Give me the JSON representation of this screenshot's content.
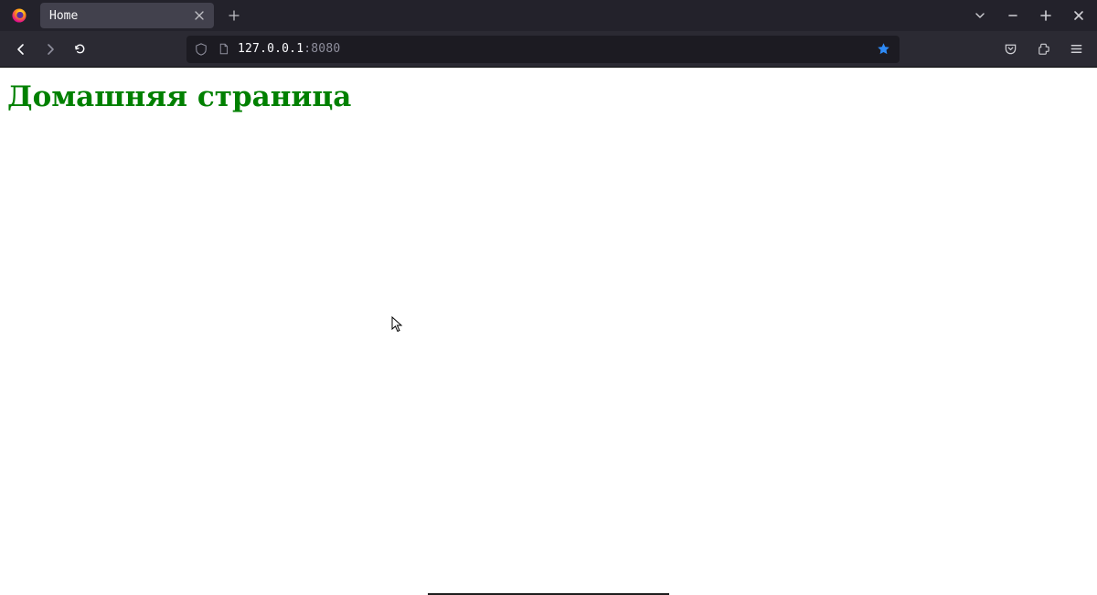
{
  "browser": {
    "tab_title": "Home",
    "url_host": "127.0.0.1",
    "url_port": ":8080"
  },
  "page": {
    "heading": "Домашняя страница"
  }
}
